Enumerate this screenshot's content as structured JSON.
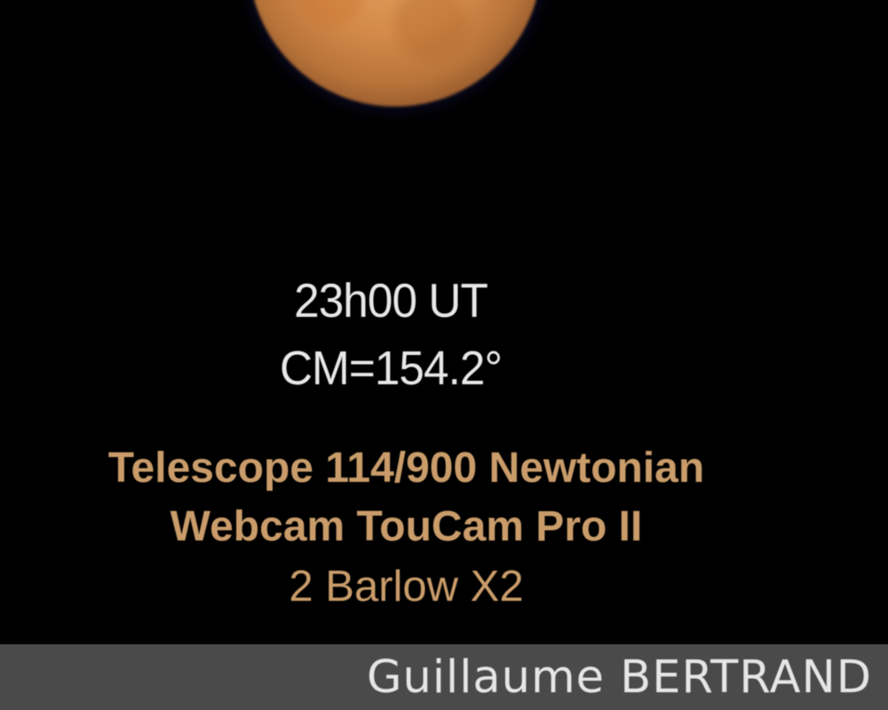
{
  "observation": {
    "time": "23h00 UT",
    "central_meridian": "CM=154.2°"
  },
  "equipment": [
    "Telescope 114/900 Newtonian",
    "Webcam TouCam Pro II",
    "2 Barlow X2"
  ],
  "credit": "Guillaume BERTRAND",
  "colors": {
    "background": "#000000",
    "planet": "#d48b4a",
    "observation_text": "#e8e8e8",
    "equipment_text": "#c99c6a",
    "credit_bar": "#4a4a4a",
    "credit_text": "#e6e6e6"
  }
}
